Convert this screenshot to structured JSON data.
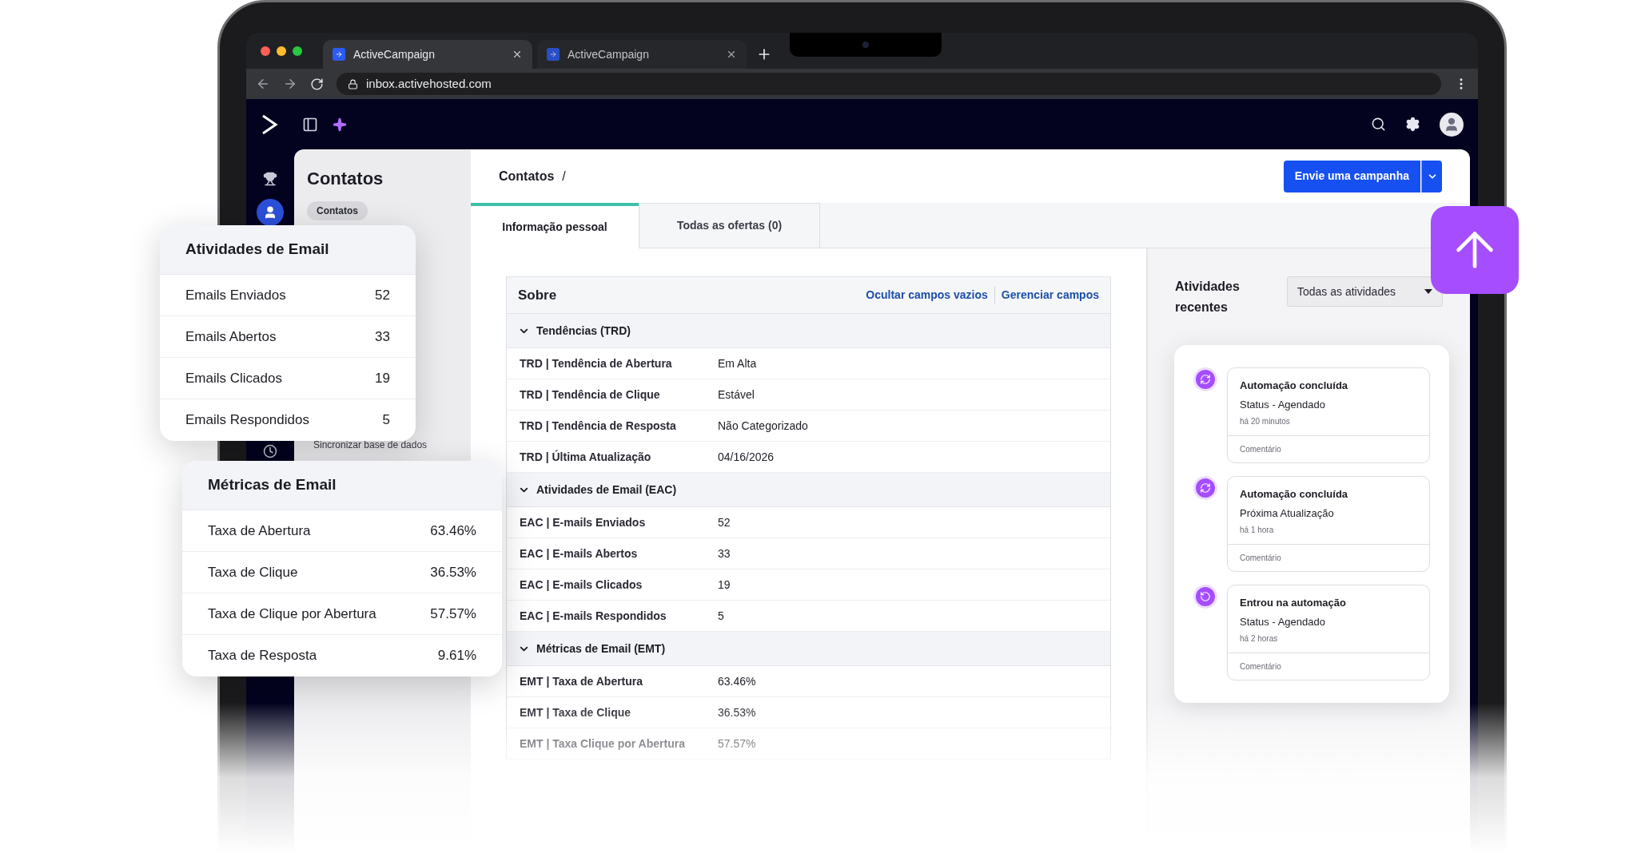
{
  "browser": {
    "tabs": [
      {
        "title": "ActiveCampaign",
        "selected": true
      },
      {
        "title": "ActiveCampaign",
        "selected": false
      }
    ],
    "address": "inbox.activehosted.com"
  },
  "sidebar": {
    "icons": [
      {
        "kind": "trophy",
        "selected": false
      },
      {
        "kind": "contact",
        "selected": true
      },
      {
        "kind": "clock",
        "selected": false
      }
    ]
  },
  "contacts_panel": {
    "title": "Contatos",
    "pill": "Contatos",
    "item": "Sincronizar base de dados"
  },
  "breadcrumb": {
    "label": "Contatos",
    "separator": "/"
  },
  "primary_button": "Envie uma campanha",
  "tabs": [
    {
      "label": "Informação pessoal",
      "selected": true
    },
    {
      "label": "Todas as ofertas (0)",
      "selected": false
    }
  ],
  "about": {
    "title": "Sobre",
    "links": [
      "Ocultar campos vazios",
      "Gerenciar campos"
    ],
    "sections": [
      {
        "title": "Tendências (TRD)",
        "expanded": true,
        "rows": [
          {
            "label": "TRD | Tendência de Abertura",
            "value": "Em Alta"
          },
          {
            "label": "TRD | Tendência de Clique",
            "value": "Estável"
          },
          {
            "label": "TRD | Tendência de Resposta",
            "value": "Não Categorizado"
          },
          {
            "label": "TRD | Última Atualização",
            "value": "04/16/2026"
          }
        ]
      },
      {
        "title": "Atividades de Email (EAC)",
        "expanded": true,
        "rows": [
          {
            "label": "EAC | E-mails Enviados",
            "value": "52"
          },
          {
            "label": "EAC | E-mails Abertos",
            "value": "33"
          },
          {
            "label": "EAC | E-mails Clicados",
            "value": "19"
          },
          {
            "label": "EAC | E-mails Respondidos",
            "value": "5"
          }
        ]
      },
      {
        "title": "Métricas de Email (EMT)",
        "expanded": true,
        "rows": [
          {
            "label": "EMT | Taxa de Abertura",
            "value": "63.46%"
          },
          {
            "label": "EMT | Taxa de Clique",
            "value": "36.53%"
          },
          {
            "label": "EMT | Taxa Clique por Abertura",
            "value": "57.57%"
          }
        ]
      }
    ]
  },
  "recent_activities": {
    "title": "Atividades recentes",
    "filter": "Todas as atividades",
    "items": [
      {
        "kind": "sync",
        "title": "Automação concluída",
        "detail": "Status - Agendado",
        "time": "há 20 minutos",
        "comment": "Comentário"
      },
      {
        "kind": "sync",
        "title": "Automação concluída",
        "detail": "Próxima Atualização",
        "time": "há 1 hora",
        "comment": "Comentário"
      },
      {
        "kind": "restart",
        "title": "Entrou na automação",
        "detail": "Status - Agendado",
        "time": "há 2 horas",
        "comment": "Comentário"
      }
    ]
  },
  "email_activities_card": {
    "title": "Atividades de Email",
    "rows": [
      {
        "label": "Emails Enviados",
        "value": "52"
      },
      {
        "label": "Emails Abertos",
        "value": "33"
      },
      {
        "label": "Emails Clicados",
        "value": "19"
      },
      {
        "label": "Emails Respondidos",
        "value": "5"
      }
    ]
  },
  "email_metrics_card": {
    "title": "Métricas de Email",
    "rows": [
      {
        "label": "Taxa de Abertura",
        "value": "63.46%"
      },
      {
        "label": "Taxa de Clique",
        "value": "36.53%"
      },
      {
        "label": "Taxa de Clique por Abertura",
        "value": "57.57%"
      },
      {
        "label": "Taxa de Resposta",
        "value": "9.61%"
      }
    ]
  }
}
